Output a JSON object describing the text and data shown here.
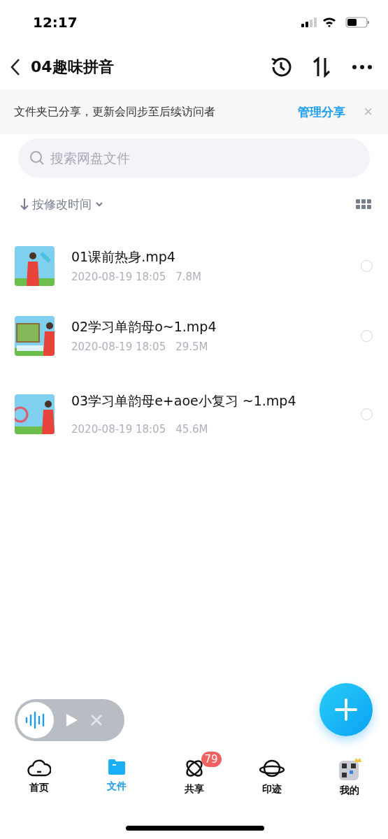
{
  "status_bar": {
    "time": "12:17"
  },
  "header": {
    "title": "04趣味拼音"
  },
  "share_banner": {
    "message": "文件夹已分享，更新会同步至后续访问者",
    "action": "管理分享",
    "close": "×"
  },
  "search": {
    "placeholder": "搜索网盘文件"
  },
  "sort": {
    "label": "按修改时间"
  },
  "files": [
    {
      "name": "01课前热身.mp4",
      "date": "2020-08-19 18:05",
      "size": "7.8M",
      "selected": false
    },
    {
      "name": "02学习单韵母o~1.mp4",
      "date": "2020-08-19 18:05",
      "size": "29.5M",
      "selected": false
    },
    {
      "name": "03学习单韵母e+aoe小复习 ~1.mp4",
      "date": "2020-08-19 18:05",
      "size": "45.6M",
      "selected": false
    }
  ],
  "tabs": [
    {
      "label": "首页",
      "selected": false
    },
    {
      "label": "文件",
      "selected": true
    },
    {
      "label": "共享",
      "selected": false,
      "badge": "79"
    },
    {
      "label": "印迹",
      "selected": false
    },
    {
      "label": "我的",
      "selected": false
    }
  ]
}
